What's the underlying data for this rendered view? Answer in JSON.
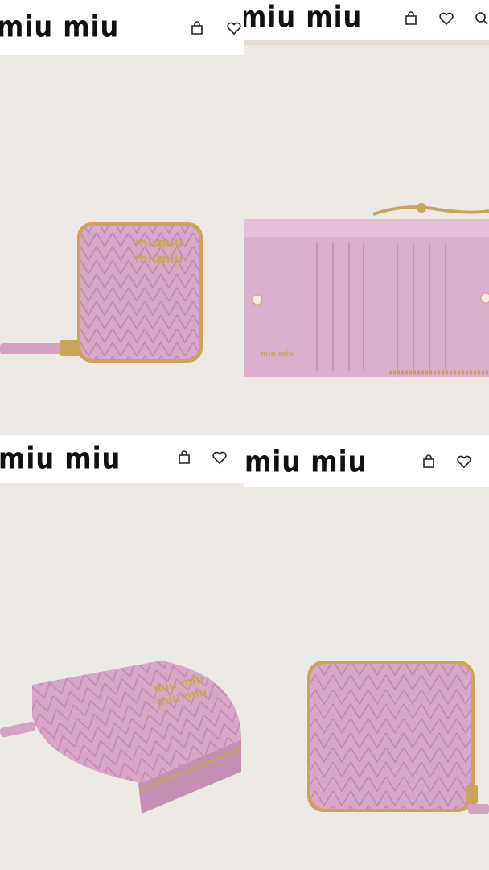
{
  "brand": {
    "logo_text": "miu miu"
  },
  "icons": {
    "bag": "shopping-bag-icon",
    "heart": "heart-icon",
    "search": "search-icon"
  },
  "product": {
    "wallet_logo": "miu miu",
    "inner_stamp": "miu miu"
  },
  "colors": {
    "background": "#ede9e4",
    "wallet_pink": "#d9a7c8",
    "wallet_pink_dark": "#b983a8",
    "hardware_gold": "#c9a45a",
    "header_bg": "#ffffff",
    "logo_color": "#111111"
  }
}
